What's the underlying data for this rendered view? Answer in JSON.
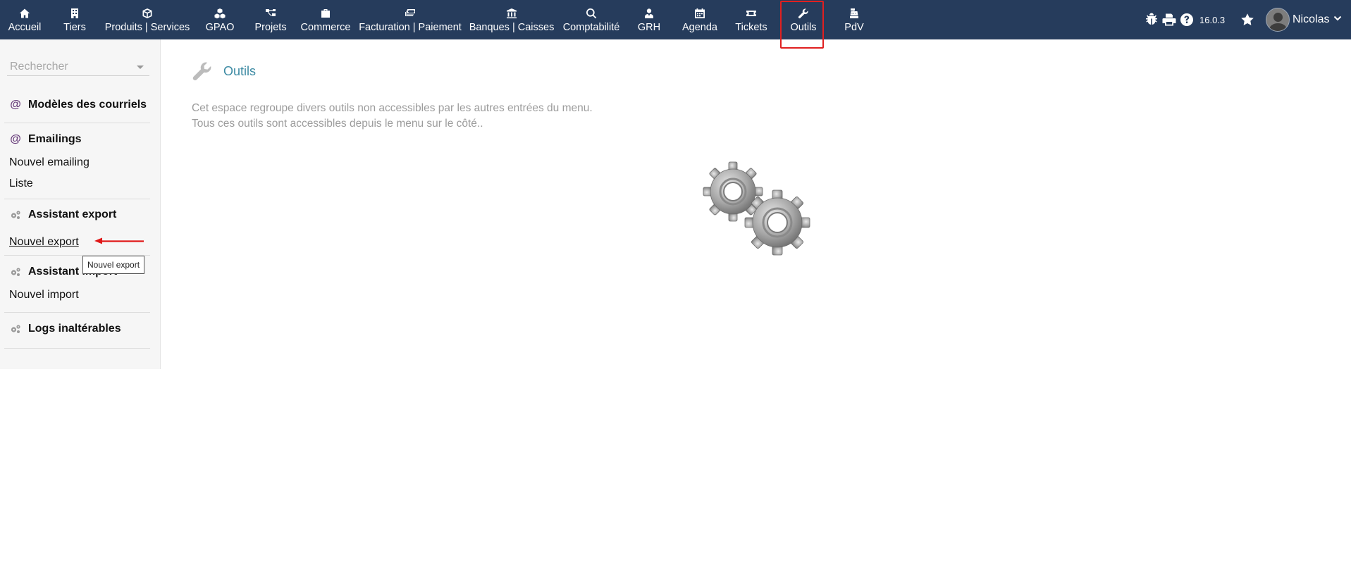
{
  "topbar": {
    "menu": [
      {
        "label": "Accueil",
        "icon": "home-icon"
      },
      {
        "label": "Tiers",
        "icon": "building-icon"
      },
      {
        "label": "Produits | Services",
        "icon": "cube-icon"
      },
      {
        "label": "GPAO",
        "icon": "cubes-icon"
      },
      {
        "label": "Projets",
        "icon": "sitemap-icon"
      },
      {
        "label": "Commerce",
        "icon": "briefcase-icon"
      },
      {
        "label": "Facturation | Paiement",
        "icon": "bills-icon"
      },
      {
        "label": "Banques | Caisses",
        "icon": "bank-icon"
      },
      {
        "label": "Comptabilité",
        "icon": "search-dollar-icon"
      },
      {
        "label": "GRH",
        "icon": "user-tie-icon"
      },
      {
        "label": "Agenda",
        "icon": "calendar-icon"
      },
      {
        "label": "Tickets",
        "icon": "ticket-icon"
      },
      {
        "label": "Outils",
        "icon": "wrench-icon",
        "active": true
      },
      {
        "label": "PdV",
        "icon": "cash-register-icon"
      }
    ],
    "version": "16.0.3",
    "username": "Nicolas",
    "accent_color": "#263c5c",
    "highlight_color": "#e02020"
  },
  "sidebar": {
    "search_placeholder": "Rechercher",
    "sections": [
      {
        "title": "Modèles des courriels",
        "icon": "at-icon",
        "items": []
      },
      {
        "title": "Emailings",
        "icon": "at-icon",
        "items": [
          "Nouvel emailing",
          "Liste"
        ]
      },
      {
        "title": "Assistant export",
        "icon": "cogs-icon",
        "items": [
          "Nouvel export"
        ]
      },
      {
        "title": "Assistant import",
        "icon": "cogs-icon",
        "items": [
          "Nouvel import"
        ]
      },
      {
        "title": "Logs inaltérables",
        "icon": "cogs-icon",
        "items": []
      }
    ],
    "tooltip": "Nouvel export"
  },
  "main": {
    "title": "Outils",
    "desc_line1": "Cet espace regroupe divers outils non accessibles par les autres entrées du menu.",
    "desc_line2": "Tous ces outils sont accessibles depuis le menu sur le côté..",
    "title_color": "#3c8aa3"
  }
}
